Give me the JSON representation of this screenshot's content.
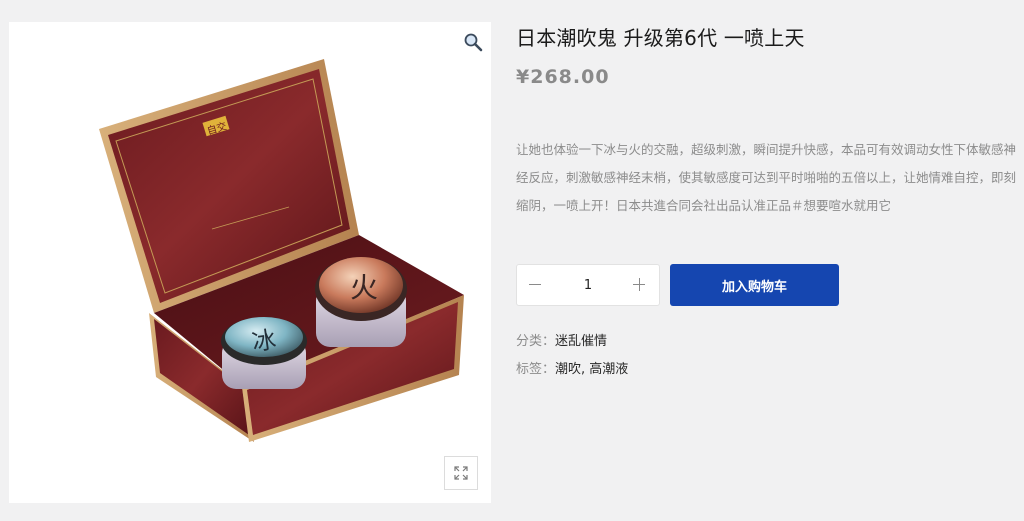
{
  "product": {
    "title": "日本潮吹鬼 升级第6代 一喷上天",
    "price": "¥268.00",
    "description": "让她也体验一下冰与火的交融，超级刺激，瞬间提升快感，本品可有效调动女性下体敏感神经反应，刺激敏感神经末梢，使其敏感度可达到平时啪啪的五倍以上，让她情难自控，即刻缩阴，一喷上开！日本共進合同会社出品认准正品＃想要喧水就用它",
    "quantity": "1",
    "add_to_cart_label": "加入购物车",
    "category_label": "分类：",
    "category_value": "迷乱催情",
    "tags_label": "标签：",
    "tags": [
      "潮吹",
      "高潮液"
    ],
    "tag_separator": ", "
  },
  "gallery": {
    "zoom_icon": "magnifier-icon",
    "expand_icon": "expand-arrows-icon",
    "box_logo_text": "自交",
    "jar_left_char": "冰",
    "jar_right_char": "火"
  },
  "colors": {
    "accent": "#1546b0",
    "price": "#8a8a8a",
    "description": "#8c8c8c"
  }
}
